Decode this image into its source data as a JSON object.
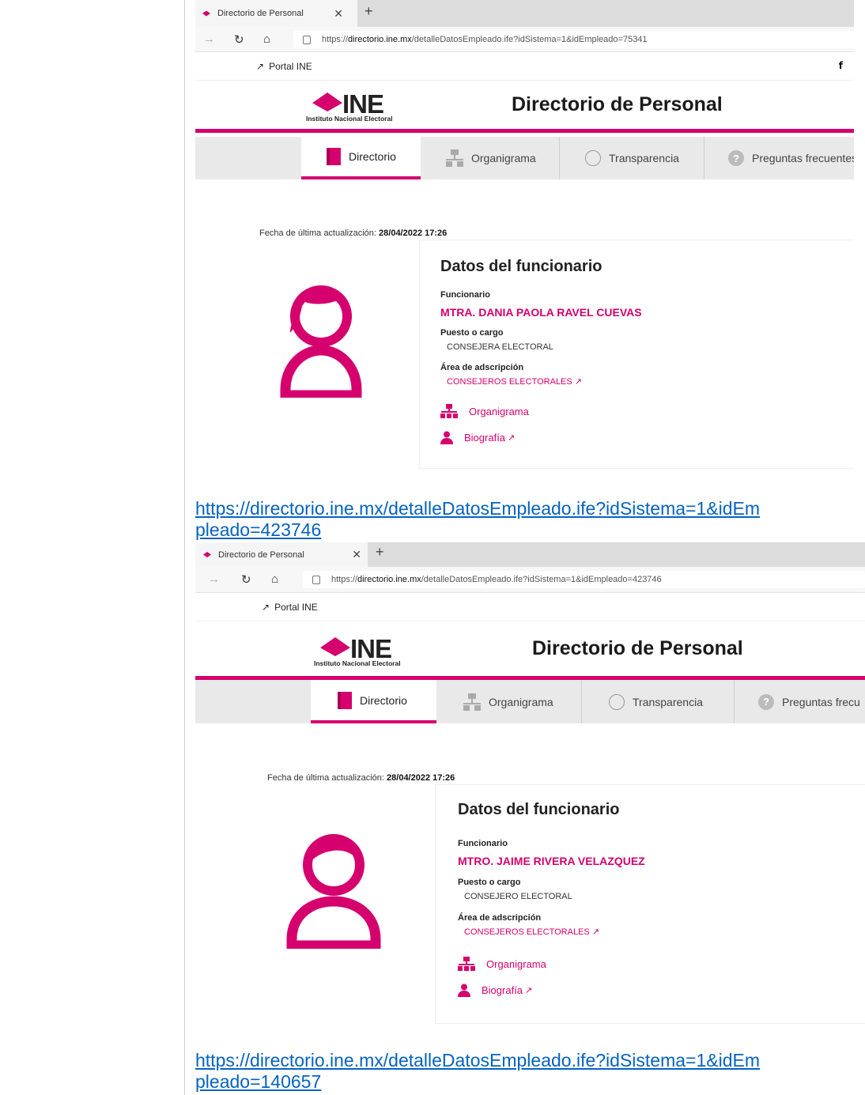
{
  "shots": [
    {
      "tab_title": "Directorio de Personal",
      "url_prefix": "https://",
      "url_host": "directorio.ine.mx",
      "url_path": "/detalleDatosEmpleado.ife?idSistema=1&idEmpleado=75341",
      "portal_label": "Portal INE",
      "facebook_glyph": "f",
      "logo_text": "INE",
      "logo_subtitle": "Instituto Nacional Electoral",
      "site_title": "Directorio de Personal",
      "nav": [
        "Directorio",
        "Organigrama",
        "Transparencia",
        "Preguntas frecuentes"
      ],
      "updated_label": "Fecha de última actualización:",
      "updated_value": "28/04/2022 17:26",
      "card_title": "Datos del funcionario",
      "official_label": "Funcionario",
      "official_name": "MTRA. DANIA PAOLA RAVEL CUEVAS",
      "position_label": "Puesto o cargo",
      "position_value": "CONSEJERA ELECTORAL",
      "area_label": "Área de adscripción",
      "area_value": "CONSEJEROS ELECTORALES",
      "org_link": "Organigrama",
      "bio_link": "Biografía"
    },
    {
      "tab_title": "Directorio de Personal",
      "url_prefix": "https://",
      "url_host": "directorio.ine.mx",
      "url_path": "/detalleDatosEmpleado.ife?idSistema=1&idEmpleado=423746",
      "portal_label": "Portal INE",
      "logo_text": "INE",
      "logo_subtitle": "Instituto Nacional Electoral",
      "site_title": "Directorio de Personal",
      "nav": [
        "Directorio",
        "Organigrama",
        "Transparencia",
        "Preguntas frecu"
      ],
      "updated_label": "Fecha de última actualización:",
      "updated_value": "28/04/2022 17:26",
      "card_title": "Datos del funcionario",
      "official_label": "Funcionario",
      "official_name": "MTRO. JAIME RIVERA VELAZQUEZ",
      "position_label": "Puesto o cargo",
      "position_value": "CONSEJERO ELECTORAL",
      "area_label": "Área de adscripción",
      "area_value": "CONSEJEROS ELECTORALES",
      "org_link": "Organigrama",
      "bio_link": "Biografía"
    }
  ],
  "doc_links": [
    "https://directorio.ine.mx/detalleDatosEmpleado.ife?idSistema=1&idEmpleado=423746",
    "https://directorio.ine.mx/detalleDatosEmpleado.ife?idSistema=1&idEmpleado=140657"
  ],
  "colors": {
    "brand": "#d5006d",
    "link": "#0563c1"
  }
}
